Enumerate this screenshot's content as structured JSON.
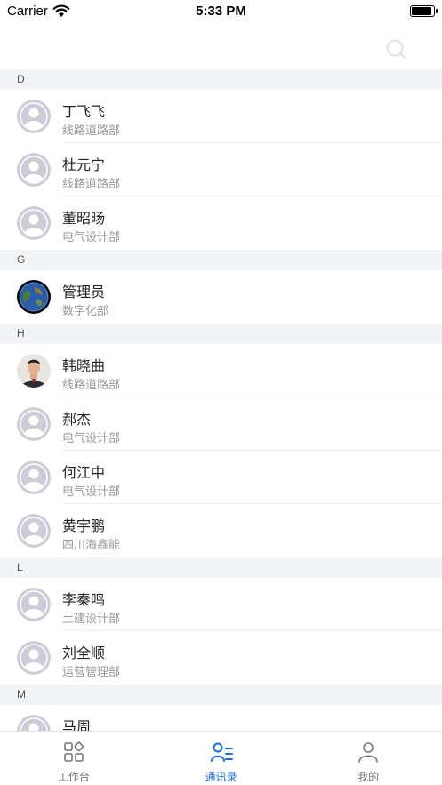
{
  "status_bar": {
    "carrier": "Carrier",
    "time": "5:33 PM"
  },
  "colors": {
    "accent": "#1a6fd6",
    "section_bg": "#f3f4f6",
    "avatar_bg": "#cfcbd8"
  },
  "sections": [
    {
      "letter": "D",
      "contacts": [
        {
          "name": "丁飞飞",
          "dept": "线路道路部",
          "avatar": "default-avatar"
        },
        {
          "name": "杜元宁",
          "dept": "线路道路部",
          "avatar": "default-avatar"
        },
        {
          "name": "董昭旸",
          "dept": "电气设计部",
          "avatar": "default-avatar"
        }
      ]
    },
    {
      "letter": "G",
      "contacts": [
        {
          "name": "管理员",
          "dept": "数字化部",
          "avatar": "earth-photo"
        }
      ]
    },
    {
      "letter": "H",
      "contacts": [
        {
          "name": "韩晓曲",
          "dept": "线路道路部",
          "avatar": "person-photo"
        },
        {
          "name": "郝杰",
          "dept": "电气设计部",
          "avatar": "default-avatar"
        },
        {
          "name": "何江中",
          "dept": "电气设计部",
          "avatar": "default-avatar"
        },
        {
          "name": "黄宇鹏",
          "dept": "四川海鑫能",
          "avatar": "default-avatar"
        }
      ]
    },
    {
      "letter": "L",
      "contacts": [
        {
          "name": "李秦鸣",
          "dept": "土建设计部",
          "avatar": "default-avatar"
        },
        {
          "name": "刘全顺",
          "dept": "运营管理部",
          "avatar": "default-avatar"
        }
      ]
    },
    {
      "letter": "M",
      "contacts": [
        {
          "name": "马周",
          "dept": "",
          "avatar": "default-avatar"
        }
      ]
    }
  ],
  "tabs": [
    {
      "label": "工作台",
      "icon": "workbench-icon",
      "active": false
    },
    {
      "label": "通讯录",
      "icon": "contacts-icon",
      "active": true
    },
    {
      "label": "我的",
      "icon": "profile-icon",
      "active": false
    }
  ]
}
